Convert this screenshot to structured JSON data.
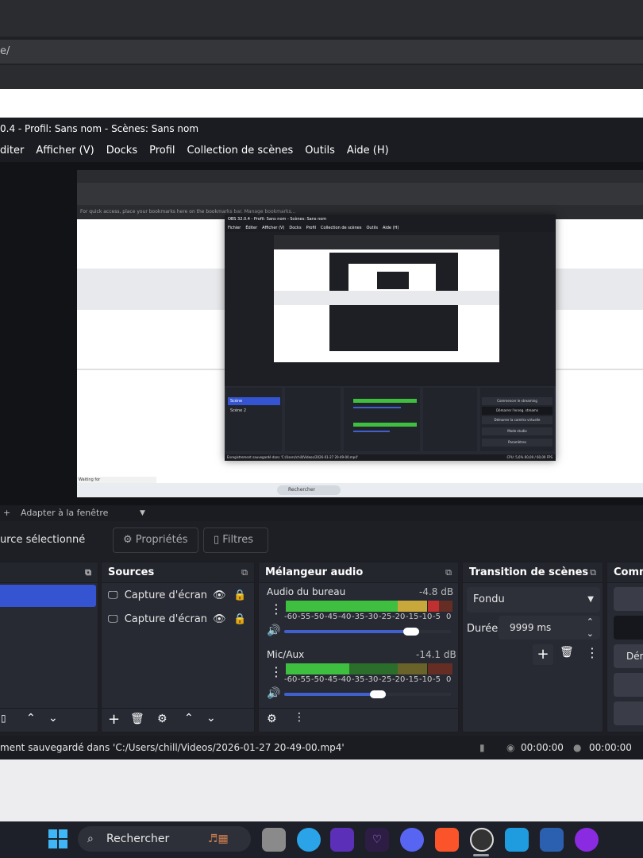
{
  "browser": {
    "url": "e/"
  },
  "obs": {
    "title": "0.4 - Profil: Sans nom - Scènes: Sans nom",
    "menu": [
      "diter",
      "Afficher (V)",
      "Docks",
      "Profil",
      "Collection de scènes",
      "Outils",
      "Aide (H)"
    ],
    "preview_toolbar": {
      "zoom_icon": "+",
      "fit_label": "Adapter à la fenêtre"
    },
    "context_bar": {
      "no_source": "urce sélectionné",
      "properties": "Propriétés",
      "filters": "Filtres"
    },
    "sources": {
      "title": "Sources",
      "items": [
        "Capture d'écran",
        "Capture d'écran"
      ]
    },
    "mixer": {
      "title": "Mélangeur audio",
      "channels": [
        {
          "name": "Audio du bureau",
          "db": "-4.8 dB",
          "level": 0.92,
          "volume": 0.76
        },
        {
          "name": "Mic/Aux",
          "db": "-14.1 dB",
          "level": 0.38,
          "volume": 0.56
        }
      ],
      "scale": [
        "-60",
        "-55",
        "-50",
        "-45",
        "-40",
        "-35",
        "-30",
        "-25",
        "-20",
        "-15",
        "-10",
        "-5",
        "0"
      ]
    },
    "transition": {
      "title": "Transition de scènes",
      "type": "Fondu",
      "duration_label": "Durée",
      "duration": "9999 ms"
    },
    "controls": {
      "title": "Comm",
      "partial_label": "Dém"
    },
    "status": {
      "recording_msg": "ment sauvegardé dans 'C:/Users/chill/Videos/2026-01-27 20-49-00.mp4'",
      "time1": "00:00:00",
      "time2": "00:00:00"
    }
  },
  "nested_preview": {
    "title": "OBS 32.0.4 - Profil: Sans nom - Scènes: Sans nom",
    "menu": [
      "Fichier",
      "Éditer",
      "Afficher (V)",
      "Docks",
      "Profil",
      "Collection de scènes",
      "Outils",
      "Aide (H)"
    ],
    "scenes": [
      "Scène",
      "Scène 2"
    ],
    "commands": [
      "Commencer le streaming",
      "Démarrer l'enreg. streams",
      "Démarrer la caméra virtuelle",
      "Mode studio",
      "Paramètres"
    ],
    "status": "Enregistrement sauvegardé dans 'C:/Users/chill/Videos/2026-01-27 20-49-00.mp4'",
    "stats": "CPU: 5,6%  60,00 / 60,00 FPS",
    "web_status": "Waiting for www.eurelasquebec.gouv.qc.ca...",
    "bookmark_hint": "For quick access, place your bookmarks here on the bookmarks bar. Manage bookmarks..."
  },
  "taskbar": {
    "search_placeholder": "Rechercher"
  },
  "colors": {
    "accent_blue": "#3454d1",
    "meter_green": "#3fbf3f",
    "meter_yellow": "#c8a83a",
    "meter_red": "#c03030"
  }
}
